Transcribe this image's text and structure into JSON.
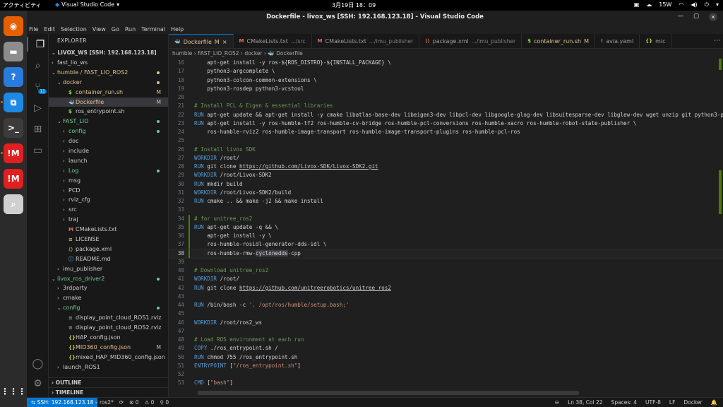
{
  "system_bar": {
    "activities": "アクティビティ",
    "app_name": "Visual Studio Code",
    "clock": "3月19日  18：09",
    "network": "15W"
  },
  "dock": {
    "items": [
      {
        "name": "firefox-icon",
        "color": "#e66000"
      },
      {
        "name": "files-icon",
        "color": "#8d8d8d"
      },
      {
        "name": "help-icon",
        "color": "#2a7bde"
      },
      {
        "name": "vscode-icon",
        "color": "#1e88e5"
      },
      {
        "name": "terminal-icon",
        "color": "#3c3c3c"
      },
      {
        "name": "app-im-icon",
        "color": "#e02020"
      },
      {
        "name": "app-im-icon-2",
        "color": "#e02020"
      },
      {
        "name": "magnifier-icon",
        "color": "#d0d0d0"
      }
    ],
    "apps_grid": "⋮⋮⋮"
  },
  "window": {
    "title": "Dockerfile - livox_ws [SSH: 192.168.123.18] - Visual Studio Code"
  },
  "menu": [
    "File",
    "Edit",
    "Selection",
    "View",
    "Go",
    "Run",
    "Terminal",
    "Help"
  ],
  "activity_bar": {
    "scm_badge": "11"
  },
  "explorer": {
    "header": "EXPLORER",
    "workspace": "LIVOX_WS [SSH: 192.168.123.18]",
    "rows": [
      {
        "indent": 1,
        "chev": "›",
        "icon": "",
        "label": "fast_lio_ws",
        "color": "#cccccc"
      },
      {
        "indent": 1,
        "chev": "⌄",
        "icon": "",
        "label": "humble / FAST_LIO_ROS2",
        "color": "#e2c08d",
        "dot": "#e2c08d"
      },
      {
        "indent": 2,
        "chev": "⌄",
        "icon": "",
        "label": "docker",
        "color": "#e2c08d",
        "dot": "#e2c08d"
      },
      {
        "indent": 3,
        "chev": "",
        "icon": "$",
        "icon_color": "#89e051",
        "label": "container_run.sh",
        "color": "#e2c08d",
        "badge": "M"
      },
      {
        "indent": 3,
        "chev": "",
        "icon": "🐳",
        "icon_color": "#2496ed",
        "label": "Dockerfile",
        "color": "#e2c08d",
        "badge": "M",
        "sel": true
      },
      {
        "indent": 3,
        "chev": "",
        "icon": "$",
        "icon_color": "#89e051",
        "label": "ros_entrypoint.sh",
        "color": "#cccccc"
      },
      {
        "indent": 2,
        "chev": "⌄",
        "icon": "",
        "label": "FAST_LIO",
        "color": "#73c991",
        "dot": "#73c991"
      },
      {
        "indent": 3,
        "chev": "›",
        "icon": "",
        "label": "config",
        "color": "#73c991",
        "dot": "#73c991"
      },
      {
        "indent": 3,
        "chev": "›",
        "icon": "",
        "label": "doc",
        "color": "#cccccc"
      },
      {
        "indent": 3,
        "chev": "›",
        "icon": "",
        "label": "include",
        "color": "#cccccc"
      },
      {
        "indent": 3,
        "chev": "›",
        "icon": "",
        "label": "launch",
        "color": "#cccccc"
      },
      {
        "indent": 3,
        "chev": "›",
        "icon": "",
        "label": "Log",
        "color": "#73c991",
        "dot": "#73c991"
      },
      {
        "indent": 3,
        "chev": "›",
        "icon": "",
        "label": "msg",
        "color": "#cccccc"
      },
      {
        "indent": 3,
        "chev": "›",
        "icon": "",
        "label": "PCD",
        "color": "#cccccc"
      },
      {
        "indent": 3,
        "chev": "›",
        "icon": "",
        "label": "rviz_cfg",
        "color": "#cccccc"
      },
      {
        "indent": 3,
        "chev": "›",
        "icon": "",
        "label": "src",
        "color": "#cccccc"
      },
      {
        "indent": 3,
        "chev": "›",
        "icon": "",
        "label": "traj",
        "color": "#cccccc"
      },
      {
        "indent": 3,
        "chev": "",
        "icon": "M",
        "icon_color": "#e06c75",
        "label": "CMakeLists.txt",
        "color": "#cccccc"
      },
      {
        "indent": 3,
        "chev": "",
        "icon": "≡",
        "icon_color": "#cbcb41",
        "label": "LICENSE",
        "color": "#cccccc"
      },
      {
        "indent": 3,
        "chev": "",
        "icon": "⟨⟩",
        "icon_color": "#e37933",
        "label": "package.xml",
        "color": "#cccccc"
      },
      {
        "indent": 3,
        "chev": "",
        "icon": "ⓘ",
        "icon_color": "#519aba",
        "label": "README.md",
        "color": "#cccccc"
      },
      {
        "indent": 2,
        "chev": "›",
        "icon": "",
        "label": "imu_publisher",
        "color": "#cccccc"
      },
      {
        "indent": 1,
        "chev": "⌄",
        "icon": "",
        "label": "livox_ros_driver2",
        "color": "#73c991",
        "dot": "#73c991"
      },
      {
        "indent": 2,
        "chev": "›",
        "icon": "",
        "label": "3rdparty",
        "color": "#cccccc"
      },
      {
        "indent": 2,
        "chev": "›",
        "icon": "",
        "label": "cmake",
        "color": "#cccccc"
      },
      {
        "indent": 2,
        "chev": "⌄",
        "icon": "",
        "label": "config",
        "color": "#73c991",
        "dot": "#73c991"
      },
      {
        "indent": 3,
        "chev": "",
        "icon": "≡",
        "icon_color": "#9da5b4",
        "label": "display_point_cloud_ROS1.rviz",
        "color": "#cccccc"
      },
      {
        "indent": 3,
        "chev": "",
        "icon": "≡",
        "icon_color": "#9da5b4",
        "label": "display_point_cloud_ROS2.rviz",
        "color": "#cccccc"
      },
      {
        "indent": 3,
        "chev": "",
        "icon": "{}",
        "icon_color": "#cbcb41",
        "label": "HAP_config.json",
        "color": "#cccccc"
      },
      {
        "indent": 3,
        "chev": "",
        "icon": "{}",
        "icon_color": "#cbcb41",
        "label": "MID360_config.json",
        "color": "#e2c08d",
        "badge": "M"
      },
      {
        "indent": 3,
        "chev": "",
        "icon": "{}",
        "icon_color": "#cbcb41",
        "label": "mixed_HAP_MID360_config.json",
        "color": "#cccccc"
      },
      {
        "indent": 2,
        "chev": "›",
        "icon": "",
        "label": "launch_ROS1",
        "color": "#cccccc"
      }
    ],
    "outline": "OUTLINE",
    "timeline": "TIMELINE"
  },
  "tabs": [
    {
      "icon": "🐳",
      "icon_color": "#2496ed",
      "label": "Dockerfile",
      "desc": "",
      "mod": "M",
      "active": true
    },
    {
      "icon": "M",
      "icon_color": "#e06c75",
      "label": "CMakeLists.txt",
      "desc": ".../src"
    },
    {
      "icon": "M",
      "icon_color": "#e06c75",
      "label": "CMakeLists.txt",
      "desc": ".../imu_publisher"
    },
    {
      "icon": "⟨⟩",
      "icon_color": "#e37933",
      "label": "package.xml",
      "desc": ".../imu_publisher"
    },
    {
      "icon": "$",
      "icon_color": "#89e051",
      "label": "container_run.sh",
      "desc": "",
      "mod": "M"
    },
    {
      "icon": "!",
      "icon_color": "#a074c4",
      "label": "avia.yaml",
      "desc": ""
    },
    {
      "icon": "{}",
      "icon_color": "#cbcb41",
      "label": "mic",
      "desc": ""
    }
  ],
  "tab_more": "⋯",
  "breadcrumb": "humble  ›  FAST_LIO_ROS2  ›  docker  ›  🐳 Dockerfile",
  "code": [
    {
      "n": "16",
      "t": "    apt-get install -y ros-${ROS_DISTRO}-${INSTALL_PACKAGE} \\",
      "k": "plain"
    },
    {
      "n": "17",
      "t": "    python3-argcomplete \\",
      "k": "plain"
    },
    {
      "n": "18",
      "t": "    python3-colcon-common-extensions \\",
      "k": "plain"
    },
    {
      "n": "19",
      "t": "    python3-rosdep python3-vcstool",
      "k": "plain"
    },
    {
      "n": "20",
      "t": "",
      "k": "plain"
    },
    {
      "n": "21",
      "t": "# Install PCL & Eigen & essential libraries",
      "k": "comment"
    },
    {
      "n": "22",
      "kw": "RUN",
      "t": " apt-get update && apt-get install -y cmake libatlas-base-dev libeigen3-dev libpcl-dev libgoogle-glog-dev libsuitesparse-dev libglew-dev wget unzip git python3-pip",
      "k": "kw"
    },
    {
      "n": "23",
      "kw": "RUN",
      "t": " apt-get install -y ros-humble-tf2 ros-humble-cv-bridge ros-humble-pcl-conversions ros-humble-xacro ros-humble-robot-state-publisher \\",
      "k": "kw"
    },
    {
      "n": "24",
      "t": "    ros-humble-rviz2 ros-humble-image-transport ros-humble-image-transport-plugins ros-humble-pcl-ros",
      "k": "plain"
    },
    {
      "n": "25",
      "t": "",
      "k": "plain"
    },
    {
      "n": "26",
      "t": "# Install livox SDK",
      "k": "comment"
    },
    {
      "n": "27",
      "kw": "WORKDIR",
      "t": " /root/",
      "k": "kw"
    },
    {
      "n": "28",
      "kw": "RUN",
      "t": " git clone ",
      "url": "https://github.com/Livox-SDK/Livox-SDK2.git",
      "k": "kw"
    },
    {
      "n": "29",
      "kw": "WORKDIR",
      "t": " /root/Livox-SDK2",
      "k": "kw"
    },
    {
      "n": "30",
      "kw": "RUN",
      "t": " mkdir build",
      "k": "kw"
    },
    {
      "n": "31",
      "kw": "WORKDIR",
      "t": " /root/Livox-SDK2/build",
      "k": "kw"
    },
    {
      "n": "32",
      "kw": "RUN",
      "t": " cmake .. && make -j2 && make install",
      "k": "kw"
    },
    {
      "n": "33",
      "t": "",
      "k": "plain"
    },
    {
      "n": "34",
      "t": "# for unitree_ros2",
      "k": "comment",
      "gutter": "#487e02"
    },
    {
      "n": "35",
      "kw": "RUN",
      "t": " apt-get update -q && \\",
      "k": "kw",
      "gutter": "#487e02"
    },
    {
      "n": "36",
      "t": "    apt-get install -y \\",
      "k": "plain",
      "gutter": "#487e02"
    },
    {
      "n": "37",
      "t": "    ros-humble-rosidl-generator-dds-idl \\",
      "k": "plain",
      "gutter": "#487e02"
    },
    {
      "n": "38",
      "t": "    ros-humble-rmw-",
      "hl": "cyclonedds",
      "after": "-cpp",
      "k": "plain",
      "gutter": "#487e02",
      "cur": true
    },
    {
      "n": "39",
      "t": "",
      "k": "plain"
    },
    {
      "n": "40",
      "t": "# Download unitree_ros2",
      "k": "comment"
    },
    {
      "n": "41",
      "kw": "WORKDIR",
      "t": " /root/",
      "k": "kw"
    },
    {
      "n": "42",
      "kw": "RUN",
      "t": " git clone ",
      "url": "https://github.com/unitreerobotics/unitree_ros2",
      "k": "kw"
    },
    {
      "n": "43",
      "t": "",
      "k": "plain"
    },
    {
      "n": "44",
      "kw": "RUN",
      "t": " /bin/bash -c ",
      "str": "'. /opt/ros/humble/setup.bash;'",
      "k": "kw"
    },
    {
      "n": "45",
      "t": "",
      "k": "plain"
    },
    {
      "n": "46",
      "kw": "WORKDIR",
      "t": " /root/ros2_ws",
      "k": "kw"
    },
    {
      "n": "47",
      "t": "",
      "k": "plain"
    },
    {
      "n": "48",
      "t": "# Load ROS environment at each run",
      "k": "comment"
    },
    {
      "n": "49",
      "kw": "COPY",
      "t": " ./ros_entrypoint.sh /",
      "k": "kw"
    },
    {
      "n": "50",
      "kw": "RUN",
      "t": " chmod 755 /ros_entrypoint.sh",
      "k": "kw"
    },
    {
      "n": "51",
      "kw": "ENTRYPOINT",
      "t": " [",
      "str": "\"/ros_entrypoint.sh\"",
      "after": "]",
      "k": "kw"
    },
    {
      "n": "52",
      "t": "",
      "k": "plain"
    },
    {
      "n": "53",
      "kw": "CMD",
      "t": " [",
      "str": "\"bash\"",
      "after": "]",
      "k": "kw"
    }
  ],
  "status": {
    "remote": "⇋ SSH: 192.168.123.18",
    "branch": "ros2*",
    "sync": "⟳",
    "errors": "⊗ 0",
    "warnings": "⚠ 0",
    "ports": "⚲ 0",
    "position": "Ln 38, Col 22",
    "spaces": "Spaces: 4",
    "encoding": "UTF-8",
    "eol": "LF",
    "language": "Docker",
    "bell": "🔔"
  }
}
